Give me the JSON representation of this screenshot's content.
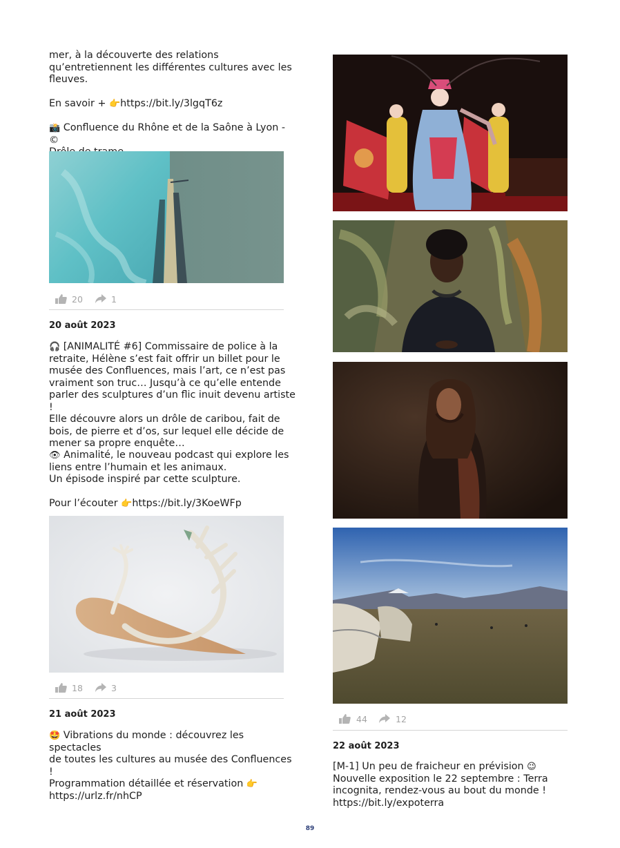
{
  "page_number": "89",
  "left": {
    "intro_lines": [
      "mer, à la découverte des relations",
      "qu’entretiennent les différentes cultures avec les",
      "fleuves."
    ],
    "more_prefix": "En savoir + ",
    "more_emoji": "👉",
    "more_link": "https://bit.ly/3lgqT6z",
    "credit_emoji": "📸",
    "credit_line1": " Confluence du Rhône et de la Saône à Lyon - ©",
    "credit_line2": "Drôle de trame",
    "post1_likes": "20",
    "post1_shares": "1",
    "post2_date": "20 août 2023",
    "post2_emoji": "🎧",
    "post2_lines": [
      "[ANIMALITÉ #6] Commissaire de police à la",
      "retraite, Hélène s’est fait offrir un billet pour le",
      "musée des Confluences, mais l’art, ce n’est pas",
      "vraiment son truc… Jusqu’à ce qu’elle entende",
      "parler des sculptures d’un flic inuit devenu artiste !",
      "Elle découvre alors un drôle de caribou, fait de",
      "bois, de pierre et d’os, sur lequel elle décide de",
      "mener sa propre enquête…"
    ],
    "post2_eye_emoji": "👁",
    "post2_para2": [
      "Animalité, le nouveau podcast qui explore les",
      "liens entre l’humain et les animaux.",
      "Un épisode inspiré par cette sculpture."
    ],
    "post2_listen_prefix": "Pour l’écouter ",
    "post2_listen_emoji": "👉",
    "post2_listen_link": "https://bit.ly/3KoeWFp",
    "post2_likes": "18",
    "post2_shares": "3",
    "post3_date": "21 août 2023",
    "post3_emoji": "🤩",
    "post3_lines": [
      " Vibrations du monde : découvrez les spectacles",
      "de toutes les cultures au musée des Confluences !",
      "Programmation détaillée et réservation "
    ],
    "post3_point_emoji": "👉",
    "post3_link": "https://urlz.fr/nhCP"
  },
  "right": {
    "post_likes": "44",
    "post_shares": "12",
    "post4_date": "22 août 2023",
    "post4_line1": "[M-1] Un peu de fraicheur en prévision ",
    "post4_wink_emoji": "😉",
    "post4_line2": "Nouvelle exposition le 22 septembre : Terra",
    "post4_line3": "incognita, rendez-vous au bout du monde !",
    "post4_link": "https://bit.ly/expoterra"
  },
  "colors": {
    "page_number": "#2c3e78",
    "reaction": "#a4a4a4",
    "separator": "#d5d5d5"
  },
  "icons": [
    "thumbs-up-icon",
    "share-arrow-icon"
  ]
}
